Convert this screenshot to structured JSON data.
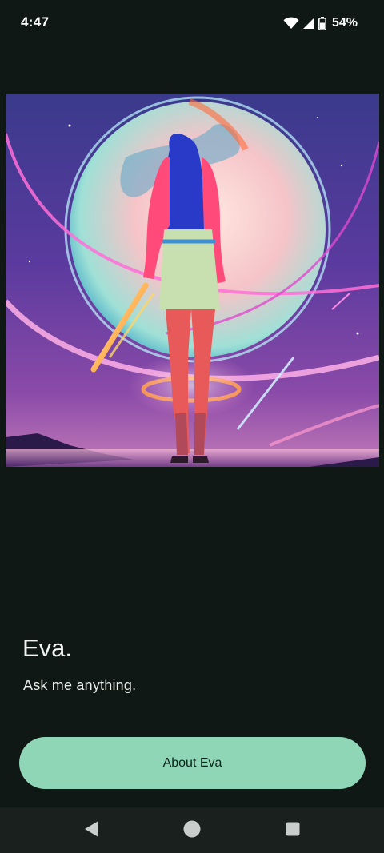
{
  "status_bar": {
    "time": "4:47",
    "battery_percent": "54%",
    "icons": [
      "wifi-icon",
      "cell-signal-icon",
      "battery-icon"
    ]
  },
  "hero": {
    "image_name": "eva-hero-illustration"
  },
  "main": {
    "title": "Eva.",
    "subtitle": "Ask me anything.",
    "about_button_label": "About Eva"
  },
  "nav_bar": {
    "buttons": [
      "back-icon",
      "home-icon",
      "recents-icon"
    ]
  },
  "colors": {
    "background": "#101816",
    "accent": "#8fd6b6",
    "nav_bar": "#1a201e",
    "button_text": "#0e231b"
  }
}
